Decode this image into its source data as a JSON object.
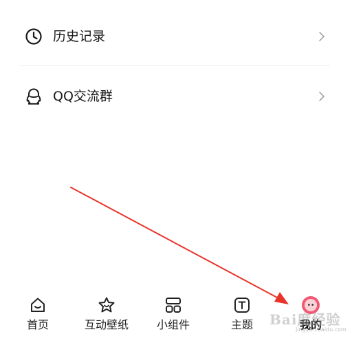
{
  "menu": {
    "items": [
      {
        "label": "历史记录",
        "icon": "clock-icon"
      },
      {
        "label": "QQ交流群",
        "icon": "qq-penguin-icon"
      }
    ]
  },
  "tabbar": {
    "tabs": [
      {
        "label": "首页",
        "icon": "home-icon"
      },
      {
        "label": "互动壁纸",
        "icon": "star-face-icon"
      },
      {
        "label": "小组件",
        "icon": "widgets-icon"
      },
      {
        "label": "主题",
        "icon": "theme-t-icon"
      },
      {
        "label": "我的",
        "icon": "avatar-icon",
        "active": true
      }
    ]
  },
  "colors": {
    "accent": "#f05a72",
    "arrow": "#e8342a",
    "text": "#1a1a1a"
  },
  "watermark": {
    "text": "Bai度经验",
    "sub": "jingyan.baidu.com"
  }
}
